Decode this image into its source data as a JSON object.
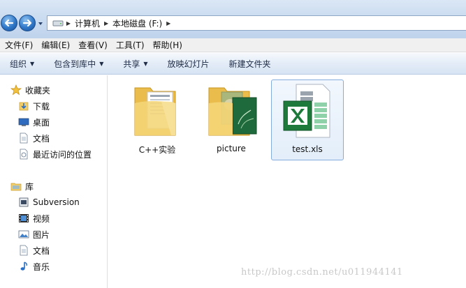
{
  "address": {
    "crumbs": [
      "计算机",
      "本地磁盘 (F:)"
    ]
  },
  "menu": [
    "文件(F)",
    "编辑(E)",
    "查看(V)",
    "工具(T)",
    "帮助(H)"
  ],
  "toolbar": {
    "organize": "组织",
    "include_in_library": "包含到库中",
    "share": "共享",
    "slideshow": "放映幻灯片",
    "new_folder": "新建文件夹"
  },
  "sidebar": {
    "favorites_title": "收藏夹",
    "favorites": [
      "下载",
      "桌面",
      "文档",
      "最近访问的位置"
    ],
    "libraries_title": "库",
    "libraries": [
      "Subversion",
      "视频",
      "图片",
      "文档",
      "音乐"
    ]
  },
  "files": [
    {
      "name": "C++实验",
      "type": "folder"
    },
    {
      "name": "picture",
      "type": "folder"
    },
    {
      "name": "test.xls",
      "type": "excel"
    }
  ],
  "watermark": "http://blog.csdn.net/u011944141",
  "colors": {
    "accent": "#2f78c8",
    "folder": "#f2cf6d",
    "excel_green": "#1e7a3a",
    "selection_border": "#84acdd"
  }
}
